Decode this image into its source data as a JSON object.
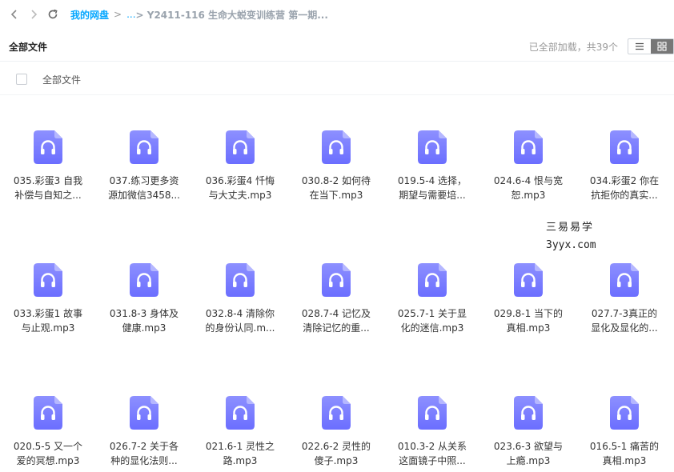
{
  "colors": {
    "accent": "#06a7ff",
    "icon_gradient_top": "#8d90ff",
    "icon_gradient_bottom": "#6b6eff",
    "icon_fold": "#b5b7ff"
  },
  "nav": {
    "back_icon": "chevron-left-icon",
    "forward_icon": "chevron-right-icon",
    "refresh_icon": "refresh-icon"
  },
  "breadcrumb": {
    "root": "我的网盘",
    "separator": ">",
    "ellipsis": "...",
    "current": "> Y2411-116 生命大蜕变训练营 第一期..."
  },
  "toolbar": {
    "title": "全部文件",
    "status": "已全部加载，共39个",
    "view_list_icon": "list-view-icon",
    "view_grid_icon": "grid-view-icon"
  },
  "select_all": {
    "label": "全部文件"
  },
  "watermark": {
    "line1": "三易易学",
    "line2": "3yyx.com"
  },
  "files": [
    {
      "line1": "035.彩蛋3 自我",
      "line2": "补偿与自知之..."
    },
    {
      "line1": "037.练习更多资",
      "line2": "源加微信3458..."
    },
    {
      "line1": "036.彩蛋4 忏悔",
      "line2": "与大丈夫.mp3"
    },
    {
      "line1": "030.8-2 如何待",
      "line2": "在当下.mp3"
    },
    {
      "line1": "019.5-4 选择，",
      "line2": "期望与需要培..."
    },
    {
      "line1": "024.6-4 恨与宽",
      "line2": "恕.mp3"
    },
    {
      "line1": "034.彩蛋2 你在",
      "line2": "抗拒你的真实..."
    },
    {
      "line1": "033.彩蛋1 故事",
      "line2": "与止观.mp3"
    },
    {
      "line1": "031.8-3 身体及",
      "line2": "健康.mp3"
    },
    {
      "line1": "032.8-4 清除你",
      "line2": "的身份认同.m..."
    },
    {
      "line1": "028.7-4 记忆及",
      "line2": "清除记忆的重..."
    },
    {
      "line1": "025.7-1 关于显",
      "line2": "化的迷信.mp3"
    },
    {
      "line1": "029.8-1 当下的",
      "line2": "真相.mp3"
    },
    {
      "line1": "027.7-3真正的",
      "line2": "显化及显化的..."
    },
    {
      "line1": "020.5-5 又一个",
      "line2": "爱的冥想.mp3"
    },
    {
      "line1": "026.7-2 关于各",
      "line2": "种的显化法则..."
    },
    {
      "line1": "021.6-1 灵性之",
      "line2": "路.mp3"
    },
    {
      "line1": "022.6-2 灵性的",
      "line2": "傻子.mp3"
    },
    {
      "line1": "010.3-2 从关系",
      "line2": "这面镜子中照..."
    },
    {
      "line1": "023.6-3 欲望与",
      "line2": "上瘾.mp3"
    },
    {
      "line1": "016.5-1 痛苦的",
      "line2": "真相.mp3"
    }
  ]
}
